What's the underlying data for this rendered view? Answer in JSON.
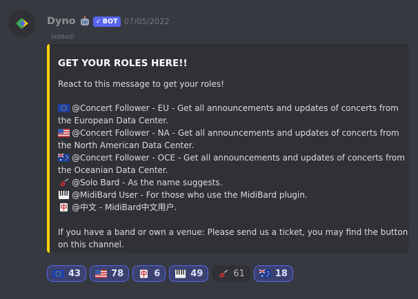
{
  "message": {
    "username": "Dyno",
    "bot_badge": "BOT",
    "timestamp": "07/05/2022",
    "edited": "(edited)"
  },
  "embed": {
    "accent_color": "#fcd00a",
    "title": "GET YOUR ROLES HERE!!",
    "intro": "React to this message to get your roles!",
    "lines": [
      {
        "icon": "eu-flag-icon",
        "text": "@Concert Follower - EU - Get all announcements and updates of concerts from"
      },
      {
        "icon": "",
        "text": "the European Data Center."
      },
      {
        "icon": "us-flag-icon",
        "text": "@Concert Follower - NA - Get all announcements and updates of concerts from"
      },
      {
        "icon": "",
        "text": "the North American Data Center."
      },
      {
        "icon": "au-flag-icon",
        "text": "@Concert Follower - OCE - Get all announcements and updates of concerts from"
      },
      {
        "icon": "",
        "text": "the Oceanian Data Center."
      },
      {
        "icon": "guitar-icon",
        "text": "@Solo Bard - As the name suggests."
      },
      {
        "icon": "piano-keys-icon",
        "text": "@MidiBard User - For those who use the MidiBard plugin."
      },
      {
        "icon": "mahjong-tile-icon",
        "text": "@中文 - MidiBard中文用户."
      }
    ],
    "footer_lines": [
      "If you have a band or own a venue: Please send us a ticket, you may find the button",
      "on this channel."
    ]
  },
  "reactions": [
    {
      "icon": "eu-flag-icon",
      "count": "43",
      "active": true
    },
    {
      "icon": "us-flag-icon",
      "count": "78",
      "active": true
    },
    {
      "icon": "mahjong-tile-icon",
      "count": "6",
      "active": true
    },
    {
      "icon": "piano-keys-icon",
      "count": "49",
      "active": true
    },
    {
      "icon": "guitar-icon",
      "count": "61",
      "active": false
    },
    {
      "icon": "au-flag-icon",
      "count": "18",
      "active": true
    }
  ]
}
